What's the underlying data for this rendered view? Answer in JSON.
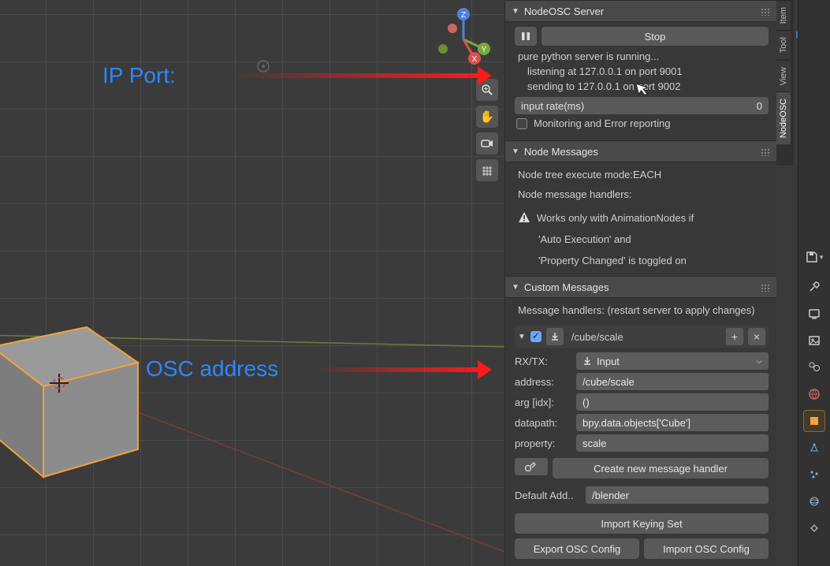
{
  "annotations": {
    "ip_port": "IP Port:",
    "osc_address": "OSC address"
  },
  "vtabs": {
    "item": "Item",
    "tool": "Tool",
    "view": "View",
    "nodeosc": "NodeOSC"
  },
  "server": {
    "title": "NodeOSC Server",
    "stop": "Stop",
    "running": "pure python server is running...",
    "listening": "listening at 127.0.0.1 on port 9001",
    "sending": "sending to 127.0.0.1 on port 9002",
    "rate_label": "input rate(ms)",
    "rate_value": "0",
    "monitoring": "Monitoring and Error reporting"
  },
  "node_msgs": {
    "title": "Node Messages",
    "exec_mode": "Node tree execute mode:EACH",
    "handlers": "Node message handlers:",
    "warn1": "Works only with AnimationNodes if",
    "warn2": "'Auto Execution' and",
    "warn3": "'Property Changed' is toggled on"
  },
  "custom": {
    "title": "Custom Messages",
    "subtitle": "Message handlers: (restart server to apply changes)",
    "item_address": "/cube/scale",
    "rxtx_label": "RX/TX:",
    "rxtx_value": "Input",
    "address_label": "address:",
    "address_value": "/cube/scale",
    "arg_label": "arg [idx]:",
    "arg_value": "()",
    "datapath_label": "datapath:",
    "datapath_value": "bpy.data.objects['Cube']",
    "property_label": "property:",
    "property_value": "scale",
    "create_btn": "Create new message handler",
    "default_label": "Default Add..",
    "default_value": "/blender",
    "import_keying": "Import Keying Set",
    "export_cfg": "Export OSC Config",
    "import_cfg": "Import OSC Config"
  }
}
